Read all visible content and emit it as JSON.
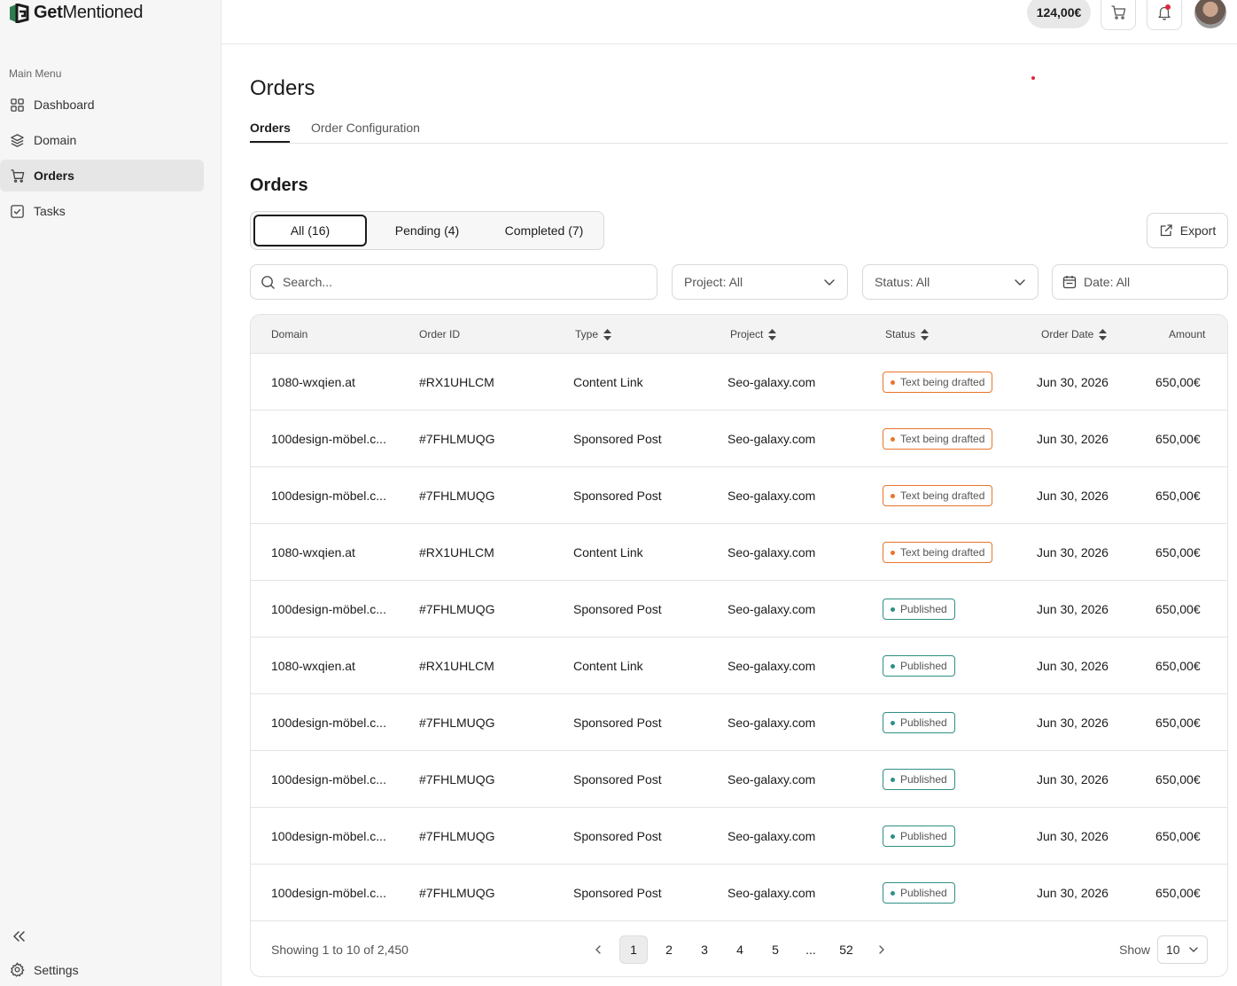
{
  "brand": {
    "name_bold": "Get",
    "name_rest": "Mentioned"
  },
  "sidebar": {
    "menu_title": "Main Menu",
    "items": [
      {
        "label": "Dashboard",
        "icon": "grid-icon"
      },
      {
        "label": "Domain",
        "icon": "layers-icon"
      },
      {
        "label": "Orders",
        "icon": "cart-icon",
        "active": true
      },
      {
        "label": "Tasks",
        "icon": "checkbox-icon"
      }
    ],
    "settings_label": "Settings"
  },
  "topbar": {
    "balance": "124,00€"
  },
  "page": {
    "title": "Orders",
    "tabs": [
      {
        "label": "Orders"
      },
      {
        "label": "Order Configuration"
      }
    ],
    "section_title": "Orders"
  },
  "filters": {
    "segments": [
      {
        "label": "All (16)"
      },
      {
        "label": "Pending (4)"
      },
      {
        "label": "Completed (7)"
      }
    ],
    "export_label": "Export",
    "search_placeholder": "Search...",
    "project": "Project: All",
    "status": "Status: All",
    "date": "Date: All"
  },
  "table": {
    "columns": [
      "Domain",
      "Order ID",
      "Type",
      "Project",
      "Status",
      "Order Date",
      "Amount"
    ],
    "rows": [
      {
        "domain": "1080-wxqien.at",
        "order_id": "#RX1UHLCM",
        "type": "Content Link",
        "project": "Seo-galaxy.com",
        "status": "Text being drafted",
        "date": "Jun 30, 2026",
        "amount": "650,00€"
      },
      {
        "domain": "100design-möbel.c...",
        "order_id": "#7FHLMUQG",
        "type": "Sponsored Post",
        "project": "Seo-galaxy.com",
        "status": "Text being drafted",
        "date": "Jun 30, 2026",
        "amount": "650,00€"
      },
      {
        "domain": "100design-möbel.c...",
        "order_id": "#7FHLMUQG",
        "type": "Sponsored Post",
        "project": "Seo-galaxy.com",
        "status": "Text being drafted",
        "date": "Jun 30, 2026",
        "amount": "650,00€"
      },
      {
        "domain": "1080-wxqien.at",
        "order_id": "#RX1UHLCM",
        "type": "Content Link",
        "project": "Seo-galaxy.com",
        "status": "Text being drafted",
        "date": "Jun 30, 2026",
        "amount": "650,00€"
      },
      {
        "domain": "100design-möbel.c...",
        "order_id": "#7FHLMUQG",
        "type": "Sponsored Post",
        "project": "Seo-galaxy.com",
        "status": "Published",
        "date": "Jun 30, 2026",
        "amount": "650,00€"
      },
      {
        "domain": "1080-wxqien.at",
        "order_id": "#RX1UHLCM",
        "type": "Content Link",
        "project": "Seo-galaxy.com",
        "status": "Published",
        "date": "Jun 30, 2026",
        "amount": "650,00€"
      },
      {
        "domain": "100design-möbel.c...",
        "order_id": "#7FHLMUQG",
        "type": "Sponsored Post",
        "project": "Seo-galaxy.com",
        "status": "Published",
        "date": "Jun 30, 2026",
        "amount": "650,00€"
      },
      {
        "domain": "100design-möbel.c...",
        "order_id": "#7FHLMUQG",
        "type": "Sponsored Post",
        "project": "Seo-galaxy.com",
        "status": "Published",
        "date": "Jun 30, 2026",
        "amount": "650,00€"
      },
      {
        "domain": "100design-möbel.c...",
        "order_id": "#7FHLMUQG",
        "type": "Sponsored Post",
        "project": "Seo-galaxy.com",
        "status": "Published",
        "date": "Jun 30, 2026",
        "amount": "650,00€"
      },
      {
        "domain": "100design-möbel.c...",
        "order_id": "#7FHLMUQG",
        "type": "Sponsored Post",
        "project": "Seo-galaxy.com",
        "status": "Published",
        "date": "Jun 30, 2026",
        "amount": "650,00€"
      }
    ]
  },
  "pagination": {
    "showing": "Showing 1 to 10 of 2,450",
    "pages": [
      "1",
      "2",
      "3",
      "4",
      "5",
      "...",
      "52"
    ],
    "current": "1",
    "show_label": "Show",
    "page_size": "10"
  },
  "colors": {
    "draft": "#e8752b",
    "published": "#2f8f84",
    "accent_dark": "#1b1b1b",
    "notification": "#e0263b"
  }
}
